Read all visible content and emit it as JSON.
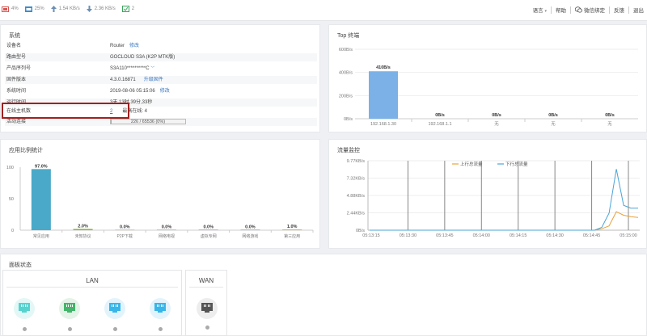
{
  "topbar": {
    "cpu": "4%",
    "mem": "25%",
    "upload": "1.54 KB/s",
    "download": "2.36 KB/s",
    "devices": "2",
    "menu": [
      "语言",
      "帮助",
      "微信绑定",
      "反馈",
      "退出"
    ]
  },
  "system": {
    "title": "系统",
    "rows": [
      {
        "key": "设备名",
        "value": "Router",
        "link": "修改"
      },
      {
        "key": "路由型号",
        "value": "GOCLOUD S3A (K2P MTK版)",
        "link": ""
      },
      {
        "key": "产品序列号",
        "value": "S3A110**********C",
        "link": ""
      },
      {
        "key": "固件版本",
        "value": "4.3.0.16871",
        "link": "升级固件"
      },
      {
        "key": "系统时间",
        "value": "2019-08-06 05:15:06",
        "link": "修改"
      },
      {
        "key": "运行时间",
        "value": "3天,13时,39分,33秒",
        "link": ""
      },
      {
        "key": "在线主机数",
        "value": "2",
        "link": ""
      },
      {
        "key": "活动连接",
        "value": "",
        "link": ""
      }
    ],
    "peak_online": "最高在线:  4",
    "conn_text": "226 / 65536 (0%)",
    "conn_pct": 0.35
  },
  "top_terminal": {
    "title": "Top 终端",
    "chart_data": {
      "type": "bar",
      "categories": [
        "192.168.1.30",
        "192.168.1.1",
        "无",
        "无",
        "无"
      ],
      "values": [
        410,
        0,
        0,
        0,
        0
      ],
      "data_labels": [
        "410B/s",
        "0B/s",
        "0B/s",
        "0B/s",
        "0B/s"
      ],
      "y_ticks": [
        "0B/s",
        "200B/s",
        "400B/s",
        "600B/s"
      ],
      "ylim": [
        0,
        600
      ],
      "color": "#7bb1e6"
    }
  },
  "app_stats": {
    "title": "应用比例统计",
    "chart_data": {
      "type": "bar",
      "categories": [
        "常见应用",
        "未知协议",
        "P2P下载",
        "网络电视",
        "虚拟专网",
        "网络游戏",
        "第三应用"
      ],
      "values": [
        97.0,
        2.0,
        0.0,
        0.0,
        0.0,
        0.0,
        1.0
      ],
      "data_labels": [
        "97.0%",
        "2.0%",
        "0.0%",
        "0.0%",
        "0.0%",
        "0.0%",
        "1.0%"
      ],
      "y_ticks": [
        "0",
        "50",
        "100"
      ],
      "ylim": [
        0,
        100
      ],
      "colors": [
        "#4aa9c9",
        "#8bb83a",
        "#e0a64b",
        "#66c28a",
        "#c46cc4",
        "#5aa0e0",
        "#d9b84a"
      ]
    }
  },
  "traffic": {
    "title": "流量监控",
    "chart_data": {
      "type": "line",
      "x_ticks": [
        "05:13:15",
        "05:13:30",
        "05:13:45",
        "05:14:00",
        "05:14:15",
        "05:14:30",
        "05:14:45",
        "05:15:00"
      ],
      "y_ticks": [
        "0B/s",
        "2.44KB/s",
        "4.88KB/s",
        "7.32KB/s",
        "9.77KB/s"
      ],
      "ylim": [
        0,
        9.77
      ],
      "series": [
        {
          "name": "上行总流量",
          "color": "#e8a23a",
          "values": [
            0,
            0,
            0,
            0,
            0,
            0,
            0,
            0,
            0,
            0,
            0,
            0,
            0,
            0,
            0,
            0,
            0,
            0,
            0,
            0,
            0,
            0,
            0,
            0,
            0,
            0,
            0,
            0,
            0,
            0,
            0,
            0,
            0.2,
            0.6,
            2.6,
            2.1,
            1.9,
            1.8
          ]
        },
        {
          "name": "下行总流量",
          "color": "#4aa3d6",
          "values": [
            0,
            0,
            0,
            0,
            0,
            0,
            0,
            0,
            0,
            0,
            0,
            0,
            0,
            0,
            0,
            0,
            0,
            0,
            0,
            0,
            0,
            0,
            0,
            0,
            0,
            0,
            0,
            0,
            0,
            0,
            0,
            0,
            0.4,
            2.4,
            8.6,
            3.5,
            3.1,
            3.1
          ]
        }
      ]
    }
  },
  "panel_status": {
    "title": "面板状态",
    "lan_label": "LAN",
    "wan_label": "WAN",
    "lan_colors": [
      "#56d3cf",
      "#43b56a",
      "#38b6e8",
      "#38b6e8"
    ],
    "wan_color": "#555555"
  }
}
